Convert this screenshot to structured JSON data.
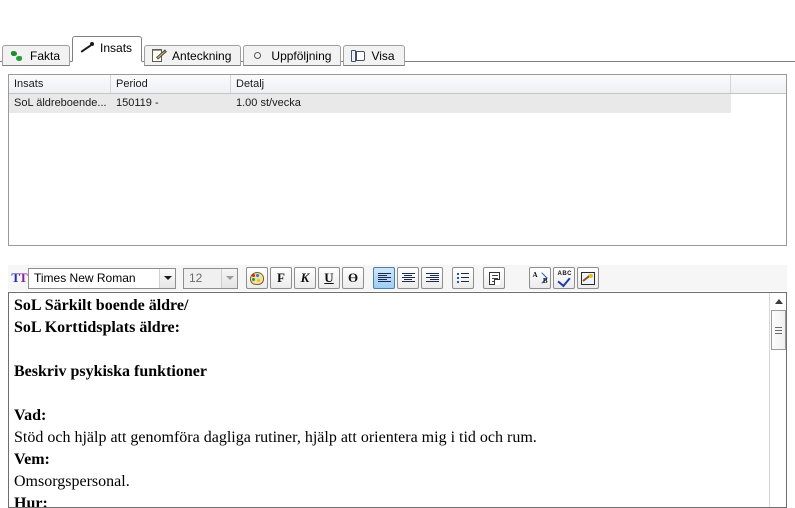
{
  "tabs": [
    {
      "label": "Fakta",
      "icon": "globe-icon",
      "active": false
    },
    {
      "label": "Insats",
      "icon": "pen-icon",
      "active": true
    },
    {
      "label": "Anteckning",
      "icon": "notepad-pencil-icon",
      "active": false
    },
    {
      "label": "Uppföljning",
      "icon": "color-wheel-icon",
      "active": false
    },
    {
      "label": "Visa",
      "icon": "book-icon",
      "active": false
    }
  ],
  "grid": {
    "columns": [
      "Insats",
      "Period",
      "Detalj",
      ""
    ],
    "rows": [
      {
        "insats": "SoL äldreboende...",
        "period": "150119 -",
        "detalj": "1.00  st/vecka",
        "extra": ""
      }
    ]
  },
  "toolbar": {
    "font_name": "Times New Roman",
    "font_size": "12",
    "buttons": {
      "color": "palette-icon",
      "bold": "F",
      "italic": "K",
      "underline": "U",
      "strikethrough": "Ө",
      "align_left": "align-left-icon",
      "align_center": "align-center-icon",
      "align_right": "align-right-icon",
      "bullets": "bullet-list-icon",
      "page": "document-icon",
      "replace": "a-to-b-icon",
      "spellcheck": "abc-check-icon",
      "wand": "wand-icon"
    }
  },
  "editor": {
    "lines": [
      {
        "text": "SoL Särkilt boende äldre/",
        "bold": true
      },
      {
        "text": "SoL Korttidsplats äldre:",
        "bold": true
      },
      {
        "text": "",
        "bold": false
      },
      {
        "text": "Beskriv psykiska funktioner",
        "bold": true
      },
      {
        "text": "",
        "bold": false
      },
      {
        "text": "Vad:",
        "bold": true
      },
      {
        "text": "Stöd och hjälp att genomföra dagliga rutiner, hjälp att orientera mig i tid och rum.",
        "bold": false
      },
      {
        "text": "Vem:",
        "bold": true
      },
      {
        "text": "Omsorgspersonal.",
        "bold": false
      },
      {
        "text": "Hur:",
        "bold": true
      }
    ]
  },
  "colors": {
    "active_button": "#9fcdf2",
    "row_highlight": "#e9e9e9",
    "border": "#808080"
  }
}
